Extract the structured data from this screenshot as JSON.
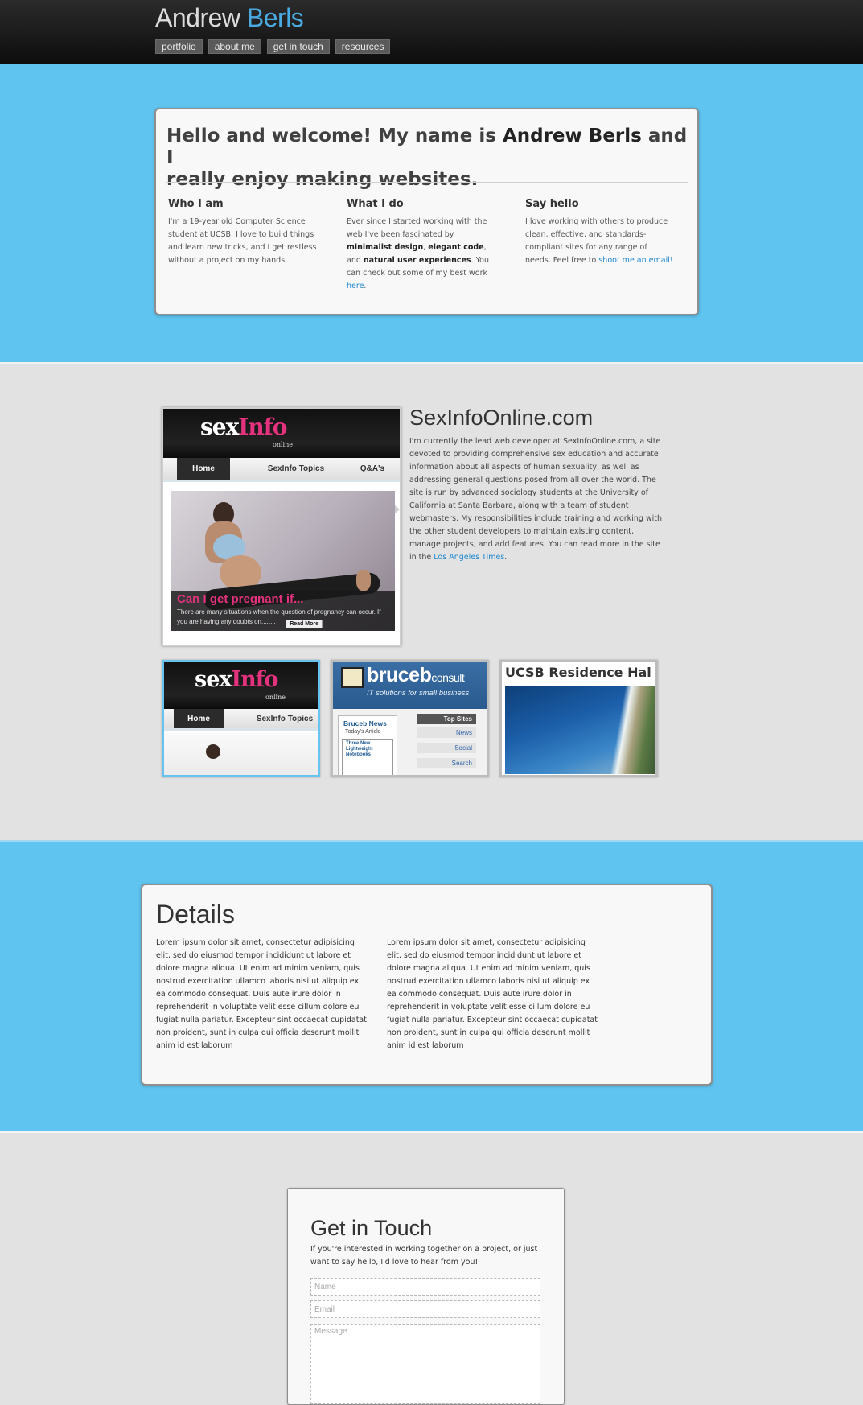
{
  "header": {
    "title_first": "Andrew",
    "title_last": "Berls",
    "nav": [
      "portfolio",
      "about me",
      "get in touch",
      "resources"
    ]
  },
  "welcome": {
    "heading_1": "Hello and welcome! My name is ",
    "heading_name": "Andrew Berls",
    "heading_2": " and I ",
    "heading_3": "really enjoy making websites.",
    "columns": [
      {
        "title": "Who I am",
        "text": "I'm a 19-year old Computer Science student at UCSB. I love to build things and learn new tricks, and I get restless without a project on my hands."
      },
      {
        "title": "What I do",
        "text_1": "Ever since I started working with the web I've been fascinated by ",
        "bold_1": "minimalist design",
        "text_2": ", ",
        "bold_2": "elegant code",
        "text_3": ", and ",
        "bold_3": "natural user experiences",
        "text_4": ". You can check out some of my best work ",
        "link": "here",
        "text_5": "."
      },
      {
        "title": "Say hello",
        "text": "I love working with others to produce clean, effective, and standards-compliant sites for any range of needs. Feel free to ",
        "link": "shoot me an email!"
      }
    ]
  },
  "portfolio": {
    "featured": {
      "logo_sex": "sex",
      "logo_info": "Info",
      "logo_online": "online",
      "tabs": [
        "Home",
        "SexInfo Topics",
        "Q&A's"
      ],
      "slide_title": "Can I get pregnant if...",
      "slide_caption": "There are many situations when the question of pregnancy can occur. If you are having any doubts on........",
      "read_more": "Read More"
    },
    "project_title": "SexInfoOnline.com",
    "project_desc": "I'm currently the lead web developer at SexInfoOnline.com, a site devoted to providing comprehensive sex education and accurate information about all aspects of human sexuality, as well as addressing general questions posed from all over the world. The site is run by advanced sociology students at the University of California at Santa Barbara, along with a team of student webmasters. My responsibilities include training and working with the other student developers to maintain existing content, manage projects, and add features. You can read more in the site in the ",
    "project_link": "Los Angeles Times",
    "project_end": ".",
    "thumb1": {
      "tabs": [
        "Home",
        "SexInfo Topics"
      ]
    },
    "thumb2": {
      "name": "bruceb",
      "name_suffix": "consult",
      "tagline": "IT solutions for small business",
      "news_title": "Bruceb News",
      "news_sub": "Today's Article",
      "article": "Three New Lightweight Notebooks",
      "side": [
        "Top Sites",
        "News",
        "Social",
        "Search"
      ]
    },
    "thumb3": {
      "title": "UCSB Residence Hal"
    }
  },
  "details": {
    "title": "Details",
    "col1": "Lorem ipsum dolor sit amet, consectetur adipisicing elit, sed do eiusmod tempor incididunt ut labore et dolore magna aliqua. Ut enim ad minim veniam, quis nostrud exercitation ullamco laboris nisi ut aliquip ex ea commodo consequat. Duis aute irure dolor in reprehenderit in voluptate velit esse cillum dolore eu fugiat nulla pariatur. Excepteur sint occaecat cupidatat non proident, sunt in culpa qui officia deserunt mollit anim id est laborum",
    "col2": "Lorem ipsum dolor sit amet, consectetur adipisicing elit, sed do eiusmod tempor incididunt ut labore et dolore magna aliqua. Ut enim ad minim veniam, quis nostrud exercitation ullamco laboris nisi ut aliquip ex ea commodo consequat. Duis aute irure dolor in reprehenderit in voluptate velit esse cillum dolore eu fugiat nulla pariatur. Excepteur sint occaecat cupidatat non proident, sunt in culpa qui officia deserunt mollit anim id est laborum"
  },
  "contact": {
    "title": "Get in Touch",
    "intro": "If you're interested in working together on a project, or just want to say hello, I'd love to hear from you!",
    "name_placeholder": "Name",
    "email_placeholder": "Email",
    "message_placeholder": "Message"
  },
  "colors": {
    "accent": "#4aabe2",
    "band_blue": "#5fc4ef",
    "link": "#1e88d0",
    "brand_pink": "#e5327f"
  }
}
